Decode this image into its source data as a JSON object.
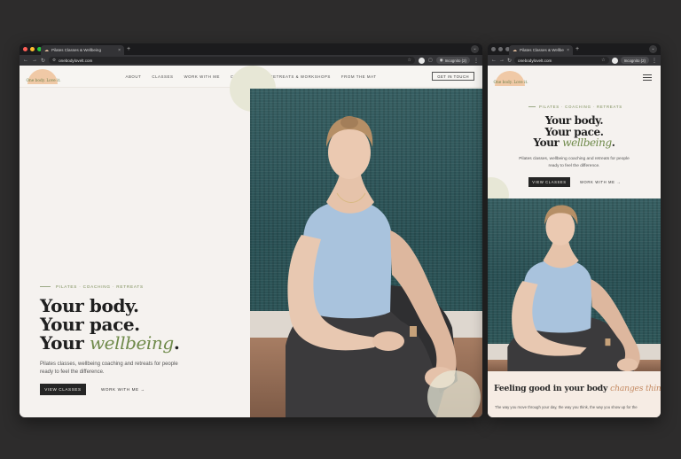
{
  "colors": {
    "page_bg": "#f5f2ef",
    "accent_green": "#6f8a4a",
    "accent_orange": "#c58b63",
    "button_dark": "#252525",
    "logo_sun": "#f0c9a6"
  },
  "browser": {
    "tab_title": "Pilates Classes & Wellbeing",
    "url": "onebodylovelt.com",
    "incognito_label": "Incognito (2)"
  },
  "site": {
    "logo_text": "One body. Love it.",
    "nav": [
      "About",
      "Classes",
      "Work with me",
      "Corporate",
      "Retreats & Workshops",
      "From the mat"
    ],
    "get_in_touch": "GET IN TOUCH",
    "eyebrow": "PILATES · COACHING · RETREATS",
    "headline_1": "Your body.",
    "headline_2": "Your pace.",
    "headline_3_prefix": "Your",
    "headline_3_accent": "wellbeing",
    "headline_3_suffix": ".",
    "sub_line_1": "Pilates classes, wellbeing coaching and retreats for people",
    "sub_line_2": "ready to feel the difference.",
    "view_classes": "VIEW CLASSES",
    "work_with_me": "WORK WITH ME →"
  },
  "mobile": {
    "feel_prefix": "Feeling good in your body",
    "feel_accent": "changes things.",
    "para": "The way you move through your day, the way you think, the way you show up for the"
  }
}
